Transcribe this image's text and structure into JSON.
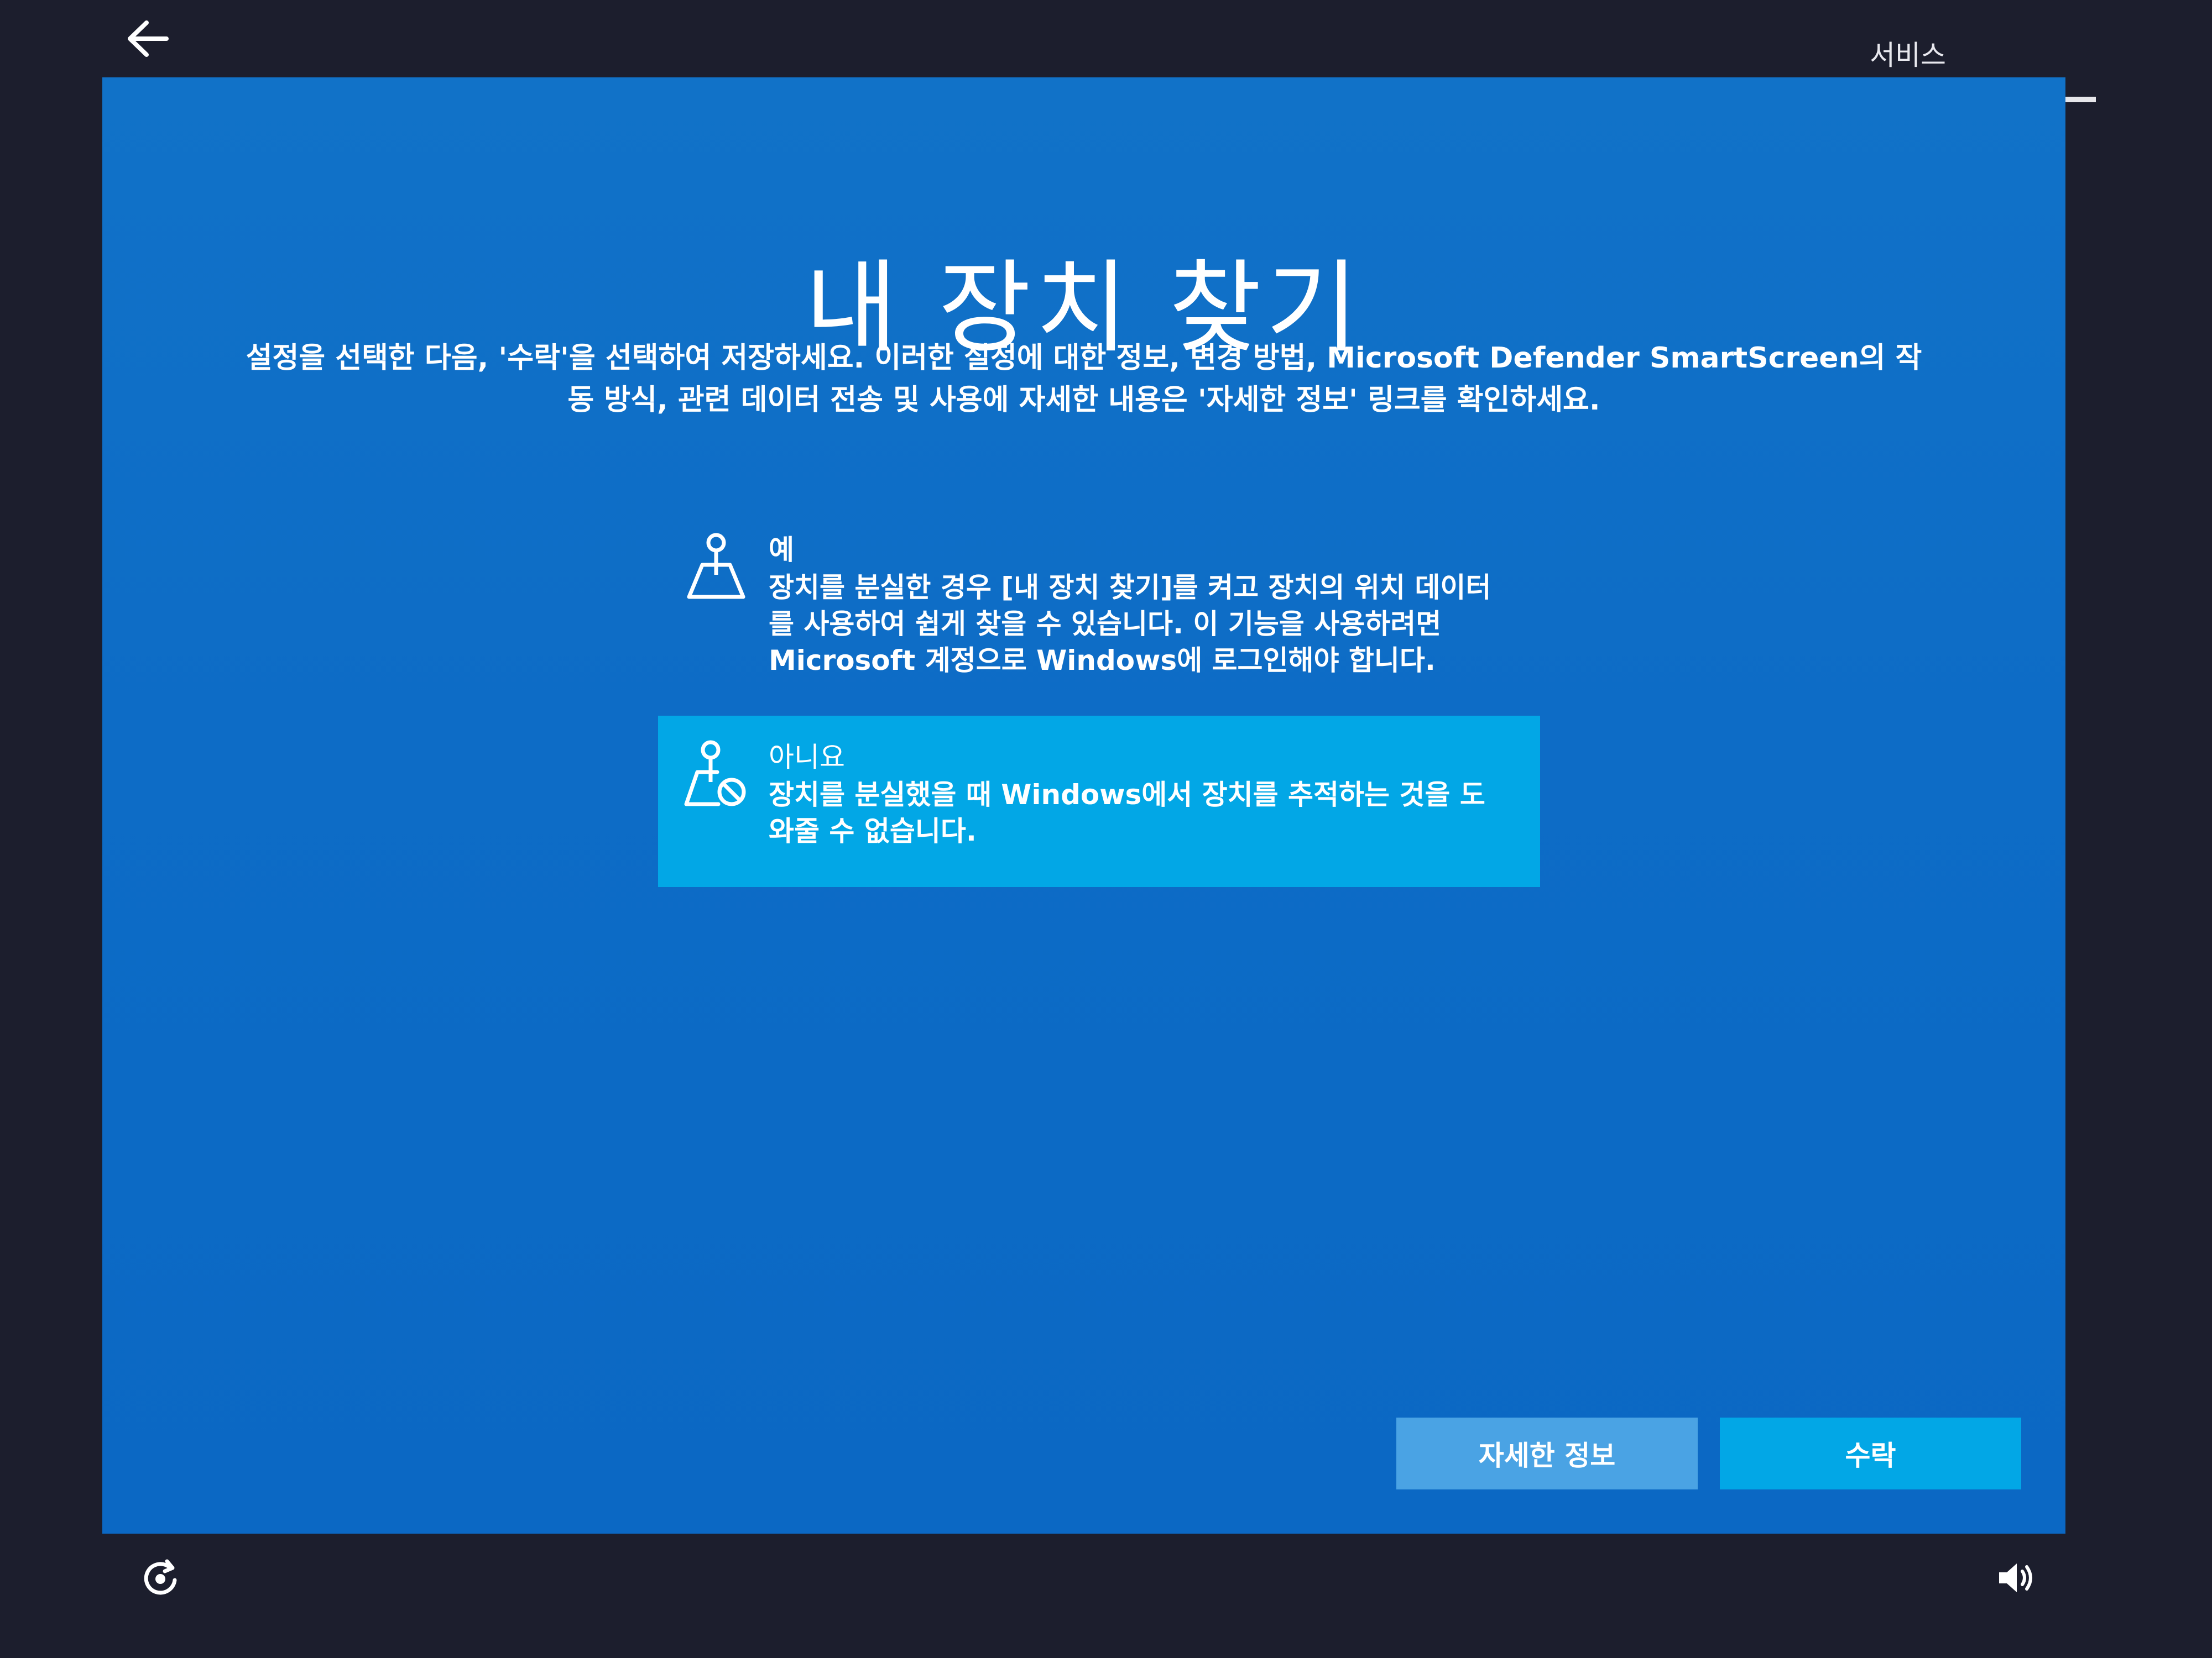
{
  "top_bar": {
    "back_icon": "arrow-left-icon",
    "tab_label": "서비스"
  },
  "main": {
    "title": "내 장치 찾기",
    "description": "설정을 선택한 다음, '수락'을 선택하여 저장하세요. 이러한 설정에 대한 정보, 변경 방법, Microsoft Defender SmartScreen의 작동 방식, 관련 데이터 전송 및 사용에 자세한 내용은 '자세한 정보' 링크를 확인하세요."
  },
  "options": [
    {
      "icon": "location-pin-map-icon",
      "title": "예",
      "description": "장치를 분실한 경우 [내 장치 찾기]를 켜고 장치의 위치 데이터를 사용하여 쉽게 찾을 수 있습니다. 이 기능을 사용하려면 Microsoft 계정으로 Windows에 로그인해야 합니다.",
      "selected": false
    },
    {
      "icon": "location-pin-blocked-icon",
      "title": "아니요",
      "description": "장치를 분실했을 때 Windows에서 장치를 추적하는 것을 도와줄 수 없습니다.",
      "selected": true
    }
  ],
  "buttons": {
    "learn_more": "자세한 정보",
    "accept": "수락"
  },
  "bottom_bar": {
    "left_icon": "accessibility-icon",
    "right_icon": "volume-icon"
  },
  "colors": {
    "background": "#1c1e2d",
    "screen": "#0d6cc6",
    "selected": "#02a7e6",
    "secondary_button": "#4aa3e4"
  }
}
